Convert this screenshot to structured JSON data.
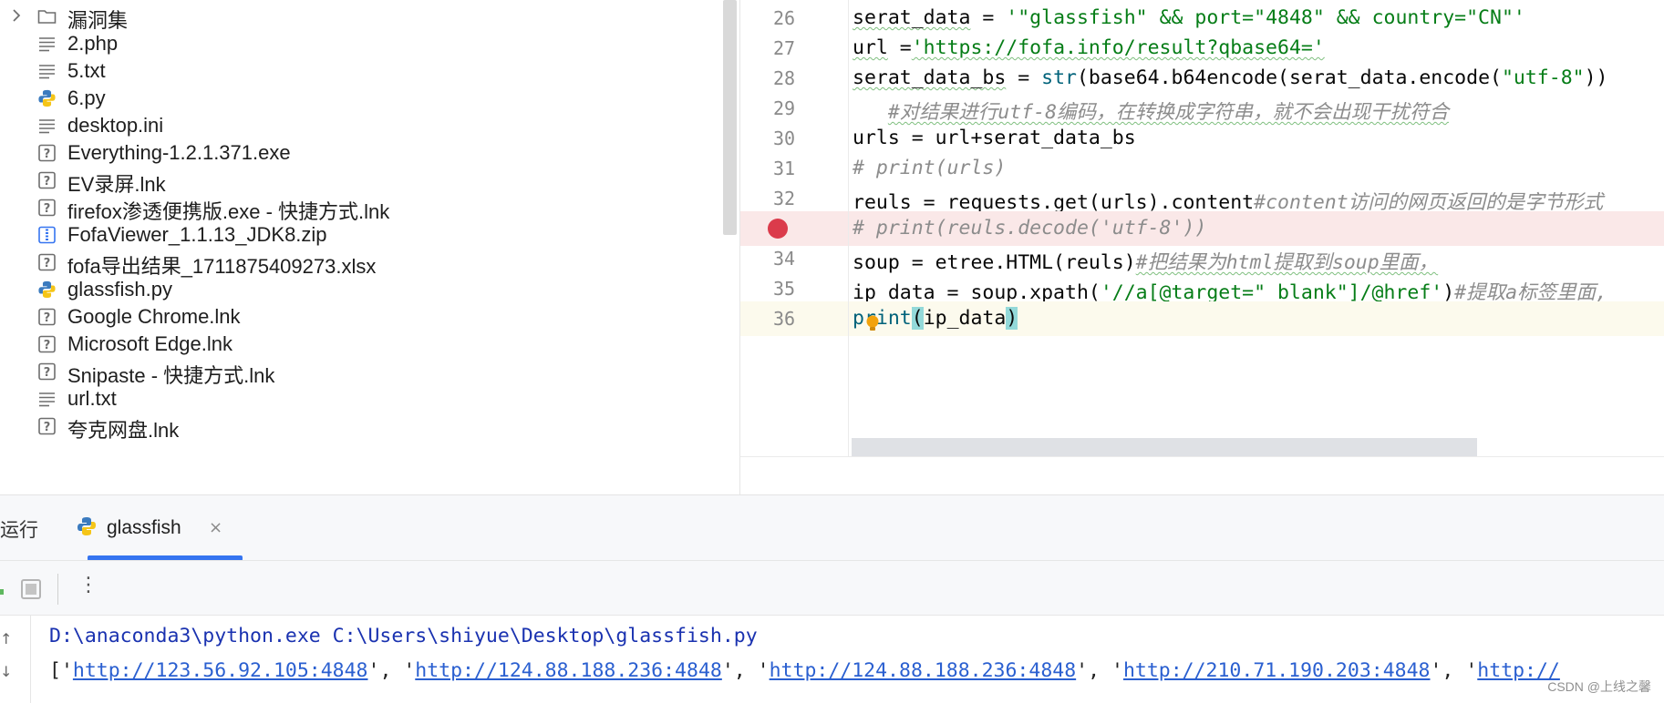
{
  "file_tree": {
    "items": [
      {
        "name": "漏洞集",
        "icon": "folder-icon",
        "expandable": true
      },
      {
        "name": "2.php",
        "icon": "text-file-icon"
      },
      {
        "name": "5.txt",
        "icon": "text-file-icon"
      },
      {
        "name": "6.py",
        "icon": "python-file-icon"
      },
      {
        "name": "desktop.ini",
        "icon": "text-file-icon"
      },
      {
        "name": "Everything-1.2.1.371.exe",
        "icon": "unknown-file-icon"
      },
      {
        "name": "EV录屏.lnk",
        "icon": "unknown-file-icon"
      },
      {
        "name": "firefox渗透便携版.exe - 快捷方式.lnk",
        "icon": "unknown-file-icon"
      },
      {
        "name": "FofaViewer_1.1.13_JDK8.zip",
        "icon": "archive-file-icon"
      },
      {
        "name": "fofa导出结果_1711875409273.xlsx",
        "icon": "unknown-file-icon"
      },
      {
        "name": "glassfish.py",
        "icon": "python-file-icon"
      },
      {
        "name": "Google Chrome.lnk",
        "icon": "unknown-file-icon"
      },
      {
        "name": "Microsoft Edge.lnk",
        "icon": "unknown-file-icon"
      },
      {
        "name": "Snipaste - 快捷方式.lnk",
        "icon": "unknown-file-icon"
      },
      {
        "name": "url.txt",
        "icon": "text-file-icon"
      },
      {
        "name": "夸克网盘.lnk",
        "icon": "unknown-file-icon"
      }
    ]
  },
  "editor": {
    "lines": [
      {
        "num": "26",
        "segments": [
          {
            "t": "serat_data",
            "c": "squig"
          },
          {
            "t": " = "
          },
          {
            "t": "'\"glassfish\" && port=\"4848\" && country=\"CN\"'",
            "c": "s-str"
          }
        ]
      },
      {
        "num": "27",
        "segments": [
          {
            "t": "url",
            "c": "squig"
          },
          {
            "t": " ="
          },
          {
            "t": "'https://fofa.info/result?qbase64='",
            "c": "s-str squig"
          }
        ]
      },
      {
        "num": "28",
        "segments": [
          {
            "t": "serat_data_bs",
            "c": "squig"
          },
          {
            "t": " = "
          },
          {
            "t": "str",
            "c": "s-fn"
          },
          {
            "t": "(base64.b64encode(serat_data.encode("
          },
          {
            "t": "\"utf-8\"",
            "c": "s-str"
          },
          {
            "t": "))"
          }
        ]
      },
      {
        "num": "29",
        "segments": [
          {
            "t": "   "
          },
          {
            "t": "#对结果进行utf-8编码，在转换成字符串，就不会出现干扰符合",
            "c": "s-cmt squig"
          }
        ]
      },
      {
        "num": "30",
        "segments": [
          {
            "t": "urls = url+serat_data_bs"
          }
        ]
      },
      {
        "num": "31",
        "segments": [
          {
            "t": "# print(urls)",
            "c": "s-cmt"
          }
        ]
      },
      {
        "num": "32",
        "segments": [
          {
            "t": "reuls",
            "c": "squig"
          },
          {
            "t": " = requests.get(urls).content"
          },
          {
            "t": "#content访问的网页返回的是字节形式",
            "c": "s-cmt"
          }
        ]
      },
      {
        "num": "33",
        "breakpoint": true,
        "segments": [
          {
            "t": "# print(reuls.decode('utf-8'))",
            "c": "s-cmt"
          }
        ]
      },
      {
        "num": "34",
        "segments": [
          {
            "t": "soup = etree.HTML(reuls)"
          },
          {
            "t": "#把结果为html提取到soup里面，",
            "c": "s-cmt squig"
          }
        ]
      },
      {
        "num": "35",
        "segments": [
          {
            "t": "ip_data",
            "c": "squig"
          },
          {
            "t": " = soup.xpath("
          },
          {
            "t": "'//a[@target=\"_blank\"]/@href'",
            "c": "s-str"
          },
          {
            "t": ")"
          },
          {
            "t": "#提取a标签里面,",
            "c": "s-cmt"
          }
        ]
      },
      {
        "num": "36",
        "current": true,
        "segments": [
          {
            "t": "print",
            "c": "s-fn"
          },
          {
            "t": "(",
            "c": "s-hl"
          },
          {
            "t": "ip_data"
          },
          {
            "t": ")",
            "c": "s-hl"
          }
        ]
      }
    ]
  },
  "run_panel": {
    "label": "运行",
    "tab_label": "glassfish",
    "tab_icon": "python-file-icon",
    "close_glyph": "×",
    "more_glyph": "⋮"
  },
  "console": {
    "command": "D:\\anaconda3\\python.exe C:\\Users\\shiyue\\Desktop\\glassfish.py",
    "output_segments": [
      {
        "t": "['"
      },
      {
        "t": "http://123.56.92.105:4848",
        "link": true
      },
      {
        "t": "', '"
      },
      {
        "t": "http://124.88.188.236:4848",
        "link": true
      },
      {
        "t": "', '"
      },
      {
        "t": "http://124.88.188.236:4848",
        "link": true
      },
      {
        "t": "', '"
      },
      {
        "t": "http://210.71.190.203:4848",
        "link": true
      },
      {
        "t": "', '"
      },
      {
        "t": "http://",
        "link": true
      }
    ],
    "arrow_up": "↑",
    "arrow_down": "↓"
  },
  "watermark": "CSDN @上线之馨",
  "colors": {
    "string": "#067d17",
    "comment": "#8c8c8c",
    "breakpoint": "#db3b4b",
    "accent": "#3574f0"
  }
}
